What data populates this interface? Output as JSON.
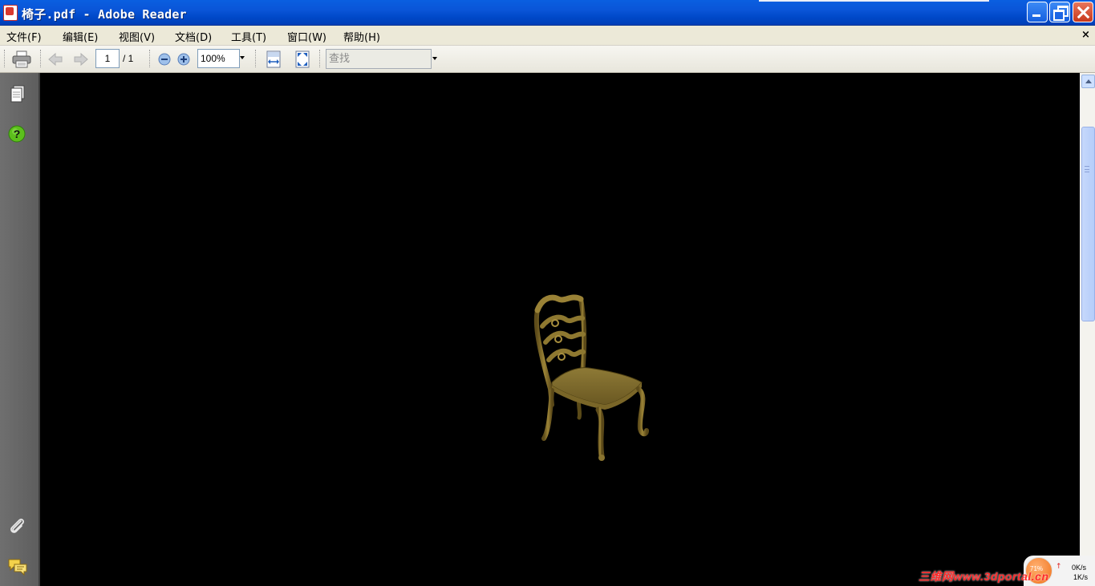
{
  "window": {
    "title": "椅子.pdf - Adobe Reader",
    "icon": "pdf-file-icon"
  },
  "menu": {
    "items": [
      {
        "label": "文件(F)"
      },
      {
        "label": "编辑(E)"
      },
      {
        "label": "视图(V)"
      },
      {
        "label": "文档(D)"
      },
      {
        "label": "工具(T)"
      },
      {
        "label": "窗口(W)"
      },
      {
        "label": "帮助(H)"
      }
    ],
    "close_doc": "×"
  },
  "toolbar": {
    "page_current": "1",
    "page_total": "/ 1",
    "zoom_value": "100%",
    "search_placeholder": "查找",
    "icons": [
      "print-icon",
      "prev-page-icon",
      "next-page-icon",
      "zoom-out-icon",
      "zoom-in-icon",
      "fit-width-icon",
      "fit-page-icon"
    ]
  },
  "leftnav": {
    "icons": [
      "pages-icon",
      "help-icon",
      "attachment-icon",
      "comments-icon"
    ]
  },
  "document": {
    "content": "3d-chair-model",
    "background_color": "#000000",
    "model_color": "#8a7430"
  },
  "overlay": {
    "watermark": "三维网www.3dportal.cn",
    "net_percent": "71%",
    "net_up": "0K/s",
    "net_down": "1K/s"
  },
  "colors": {
    "titlebar": "#0a55d8",
    "menubar": "#ece9d8",
    "leftnav": "#666666",
    "scroll_thumb": "#c0d4fa"
  }
}
